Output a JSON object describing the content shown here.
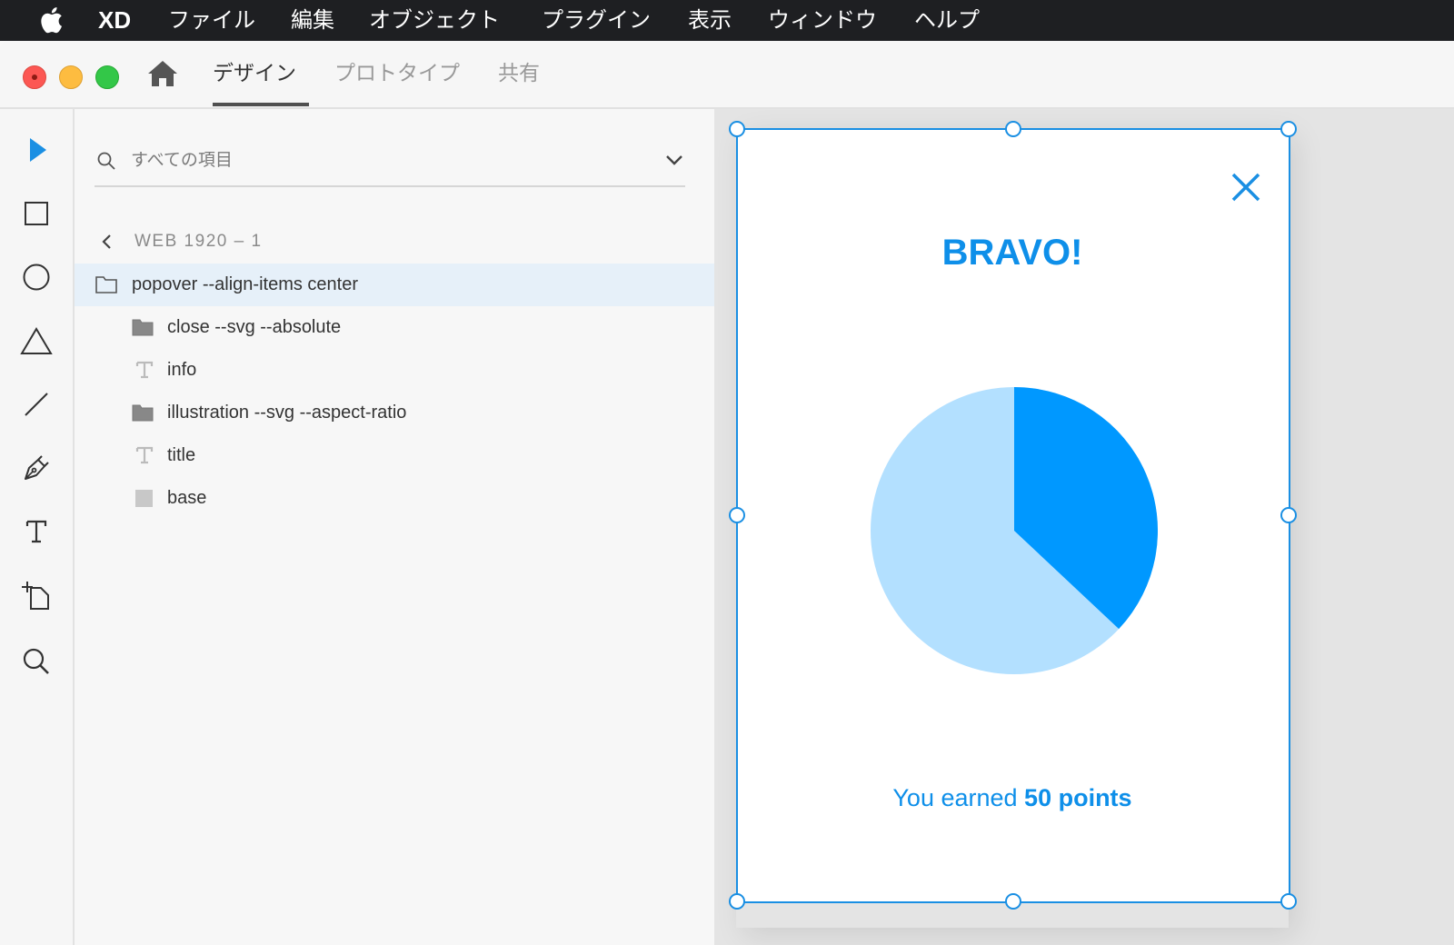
{
  "menubar": {
    "app_name": "XD",
    "items": [
      "ファイル",
      "編集",
      "オブジェクト",
      "プラグイン",
      "表示",
      "ウィンドウ",
      "ヘルプ"
    ]
  },
  "tabs": [
    {
      "label": "デザイン",
      "active": true
    },
    {
      "label": "プロトタイプ",
      "active": false
    },
    {
      "label": "共有",
      "active": false
    }
  ],
  "toolbar": {
    "tools": [
      "select-tool",
      "rectangle-tool",
      "ellipse-tool",
      "polygon-tool",
      "line-tool",
      "pen-tool",
      "text-tool",
      "artboard-tool",
      "zoom-tool"
    ]
  },
  "layers": {
    "search_placeholder": "すべての項目",
    "breadcrumb": "WEB 1920 – 1",
    "items": [
      {
        "label": "popover --align-items center",
        "type": "group-outline",
        "selected": true
      },
      {
        "label": "close --svg --absolute",
        "type": "group"
      },
      {
        "label": "info",
        "type": "text"
      },
      {
        "label": "illustration --svg --aspect-ratio",
        "type": "group"
      },
      {
        "label": "title",
        "type": "text"
      },
      {
        "label": "base",
        "type": "rectangle"
      }
    ]
  },
  "artboard": {
    "title": "BRAVO!",
    "info_prefix": "You earned ",
    "info_points": "50 points",
    "pie": {
      "fraction": 0.37,
      "filled_color": "#0098ff",
      "rest_color": "#b3e0ff"
    }
  },
  "colors": {
    "accent": "#1a8fe3",
    "text_blue": "#0e8fe9"
  }
}
